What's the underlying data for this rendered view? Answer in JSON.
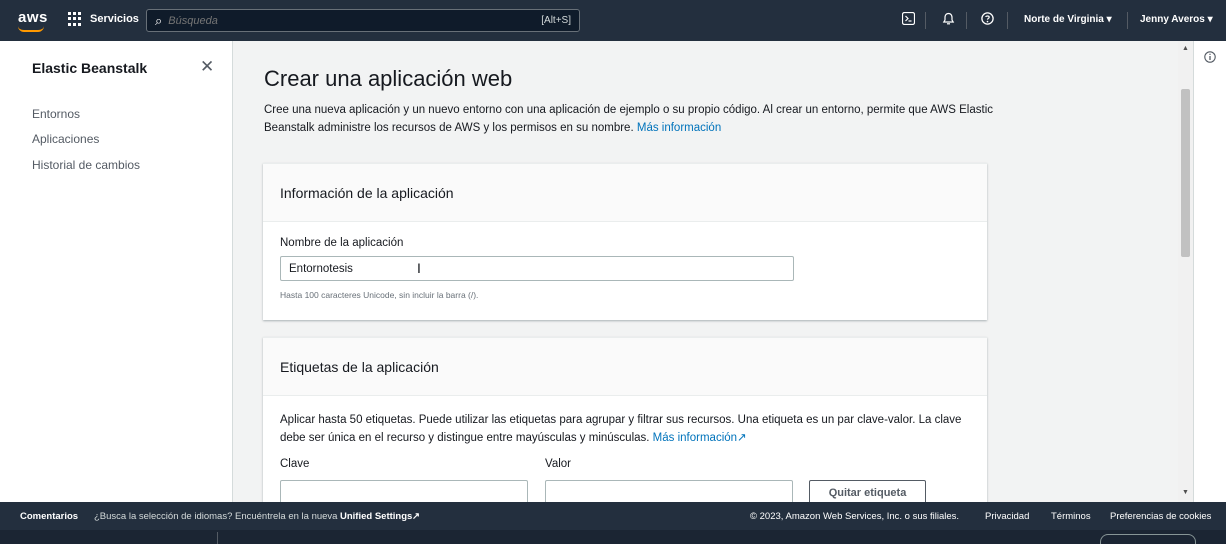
{
  "topnav": {
    "logo": "aws",
    "services_label": "Servicios",
    "search_placeholder": "Búsqueda",
    "search_shortcut": "[Alt+S]",
    "region": "Norte de Virginia ▾",
    "user": "Jenny Averos ▾",
    "icons": [
      "cloudshell-icon",
      "bell-icon",
      "help-icon"
    ]
  },
  "sidebar": {
    "title": "Elastic Beanstalk",
    "items": [
      {
        "label": "Entornos"
      },
      {
        "label": "Aplicaciones"
      },
      {
        "label": "Historial de cambios"
      }
    ]
  },
  "main": {
    "title": "Crear una aplicación web",
    "description": "Cree una nueva aplicación y un nuevo entorno con una aplicación de ejemplo o su propio código. Al crear un entorno, permite que AWS Elastic Beanstalk administre los recursos de AWS y los permisos en su nombre.",
    "more_info": "Más información",
    "app_info_panel": {
      "heading": "Información de la aplicación",
      "name_label": "Nombre de la aplicación",
      "name_value": "Entornotesis",
      "name_hint": "Hasta 100 caracteres Unicode, sin incluir la barra (/)."
    },
    "tags_panel": {
      "heading": "Etiquetas de la aplicación",
      "description": "Aplicar hasta 50 etiquetas. Puede utilizar las etiquetas para agrupar y filtrar sus recursos. Una etiqueta es un par clave-valor. La clave debe ser única en el recurso y distingue entre mayúsculas y minúsculas.",
      "more_info": "Más información",
      "key_label": "Clave",
      "value_label": "Valor",
      "key_value": "",
      "value_value": "",
      "remove_button": "Quitar etiqueta"
    }
  },
  "footer": {
    "feedback": "Comentarios",
    "language_prompt": "¿Busca la selección de idiomas? Encuéntrela en la nueva",
    "unified_settings": "Unified Settings",
    "copyright": "© 2023, Amazon Web Services, Inc. o sus filiales.",
    "privacy": "Privacidad",
    "terms": "Términos",
    "cookies": "Preferencias de cookies"
  }
}
